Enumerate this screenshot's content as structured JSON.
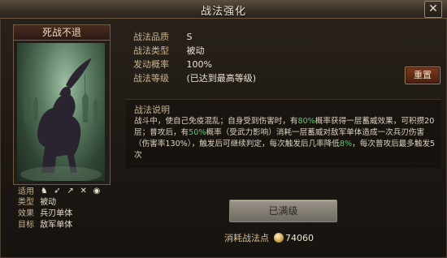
{
  "window": {
    "title": "战法强化",
    "close_icon": "close-icon"
  },
  "card": {
    "name": "死战不退"
  },
  "meta": {
    "applies_label": "适用",
    "applies_icons": [
      "cavalry-icon",
      "bow-icon",
      "spear-icon",
      "sword-icon",
      "shield-icon"
    ],
    "type_label": "类型",
    "type_value": "被动",
    "effect_label": "效果",
    "effect_value": "兵刃单体",
    "target_label": "目标",
    "target_value": "敌军单体"
  },
  "info": {
    "quality_label": "战法品质",
    "quality_value": "S",
    "category_label": "战法类型",
    "category_value": "被动",
    "trigger_label": "发动概率",
    "trigger_value": "100%",
    "level_label": "战法等级",
    "level_value": "(已达到最高等级)"
  },
  "buttons": {
    "reset": "重置",
    "maxed": "已满级"
  },
  "description": {
    "title": "战法说明",
    "p1": "战斗中，使自己免疫混乱；自身受到伤害时，有",
    "p2": "80%",
    "p3": "概率获得一层蓄威效果，可积攒20层；普攻后，有",
    "p4": "50%",
    "p5": "概率（受武力影响）消耗一层蓄威对敌军单体造成一次兵刃伤害（伤害率130%），触发后可继续判定，每次触发后几率降低",
    "p6": "8%",
    "p7": "，每次普攻后最多触发5次"
  },
  "cost": {
    "label": "消耗战法点",
    "icon": "coin-icon",
    "value": "74060"
  },
  "colors": {
    "highlight": "#57c86a",
    "label": "#c9b48f",
    "reset_button": "#7a3b20"
  }
}
